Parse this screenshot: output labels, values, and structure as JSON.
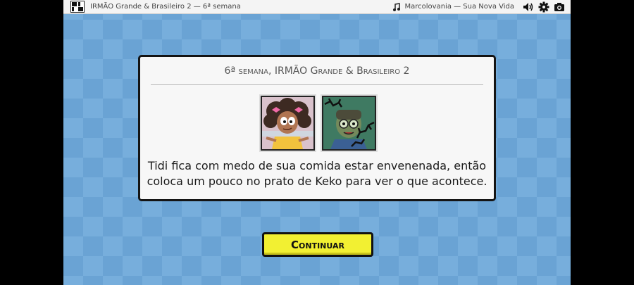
{
  "topbar": {
    "title": "IRMÃO Grande & Brasileiro 2 — 6ª semana",
    "now_playing": "Marcolovania — Sua Nova Vida",
    "icons": [
      "music-note-icon",
      "speaker-icon",
      "gear-icon",
      "camera-icon"
    ]
  },
  "dialog": {
    "title": "6ª semana, IRMÃO Grande & Brasileiro 2",
    "description_line1": "Tidi fica com medo de sua comida estar envenenada, então",
    "description_line2": "coloca um pouco no prato de Keko para ver o que acontece.",
    "cards": [
      {
        "character": "Tidi",
        "state": "active"
      },
      {
        "character": "Keko",
        "state": "poisoned"
      }
    ]
  },
  "continue_button": {
    "label": "Continuar"
  },
  "colors": {
    "background": "#77aedc",
    "button": "#f2f032",
    "panel": "#f7f7f7"
  }
}
